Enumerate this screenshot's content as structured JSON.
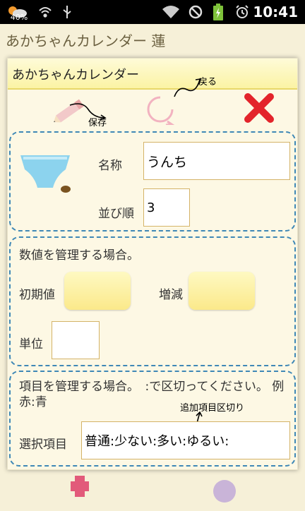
{
  "status_bar": {
    "battery_percent": "40%",
    "time": "10:41"
  },
  "background": {
    "app_title": "あかちゃんカレンダー 蓮"
  },
  "dialog": {
    "title": "あかちゃんカレンダー",
    "toolbar": {
      "save_icon": "pencil-icon",
      "back_icon": "refresh-icon",
      "close_icon": "close-icon",
      "annotation_save": "保存",
      "annotation_back": "戻る"
    },
    "basic_section": {
      "image_icon": "diaper-icon",
      "name_label": "名称",
      "name_value": "うんち",
      "order_label": "並び順",
      "order_value": "3"
    },
    "numeric_section": {
      "heading": "数値を管理する場合。",
      "initial_label": "初期値",
      "step_label": "増減",
      "unit_label": "単位"
    },
    "items_section": {
      "heading": "項目を管理する場合。　:で区切ってください。 例 赤:青",
      "annotation": "追加項目区切り",
      "select_label": "選択項目",
      "select_value": "普通:少ない:多い:ゆるい:"
    }
  },
  "colors": {
    "accent_red": "#e3242b",
    "frame_blue": "#3f88b6",
    "field_border": "#d4b368"
  }
}
